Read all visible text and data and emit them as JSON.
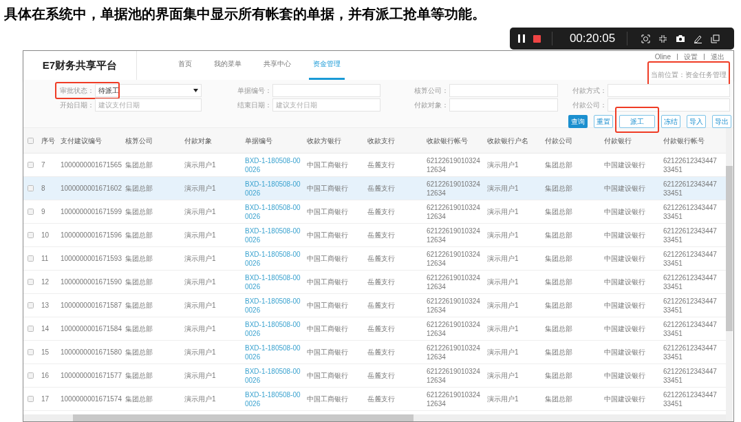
{
  "caption": "具体在系统中，单据池的界面集中显示所有帐套的单据，并有派工抢单等功能。",
  "recorder": {
    "time": "00:20:05"
  },
  "app": {
    "logo": "E7财务共享平台",
    "nav": [
      {
        "label": "首页",
        "selected": false
      },
      {
        "label": "我的菜单",
        "selected": false
      },
      {
        "label": "共享中心",
        "selected": false
      },
      {
        "label": "资金管理",
        "selected": true
      }
    ],
    "top_links": [
      "Oline",
      "设置",
      "退出"
    ],
    "location": {
      "text": "当前位置：资金任务管理",
      "highlighted": true
    }
  },
  "filters": [
    [
      {
        "label": "审批状态：",
        "kind": "select",
        "value": "待派工",
        "highlighted": true
      },
      {
        "label": "开始日期：",
        "kind": "text",
        "placeholder": "建议支付日期"
      }
    ],
    [
      {
        "label": "单据编号：",
        "kind": "text"
      },
      {
        "label": "结束日期：",
        "kind": "text",
        "placeholder": "建议支付日期"
      }
    ],
    [
      {
        "label": "核算公司：",
        "kind": "text"
      },
      {
        "label": "付款对象：",
        "kind": "text"
      }
    ],
    [
      {
        "label": "付款方式：",
        "kind": "text"
      },
      {
        "label": "付款公司：",
        "kind": "text"
      }
    ]
  ],
  "buttons": [
    {
      "label": "查询",
      "kind": "primary"
    },
    {
      "label": "重置",
      "kind": "outline"
    },
    {
      "label": "派工",
      "kind": "outline",
      "highlighted": true
    },
    {
      "label": "冻结",
      "kind": "outline"
    },
    {
      "label": "导入",
      "kind": "outline"
    },
    {
      "label": "导出",
      "kind": "outline"
    }
  ],
  "table": {
    "header_checked": false,
    "columns": [
      "序号",
      "支付建议编号",
      "核算公司",
      "付款对象",
      "单据编号",
      "收款方银行",
      "收款支行",
      "收款银行帐号",
      "收款银行户名",
      "付款公司",
      "付款银行",
      "付款银行帐号"
    ],
    "rows": [
      {
        "checked": false,
        "selected": false,
        "cells": [
          "7",
          "1000000001671565",
          "集团总部",
          "演示用户1",
          "BXD-1-180508-000026",
          "中国工商银行",
          "岳麓支行",
          "6212261901032412634",
          "演示用户1",
          "集团总部",
          "中国建设银行",
          "6212261234344733451"
        ]
      },
      {
        "checked": false,
        "selected": true,
        "cells": [
          "8",
          "1000000001671602",
          "集团总部",
          "演示用户1",
          "BXD-1-180508-000026",
          "中国工商银行",
          "岳麓支行",
          "6212261901032412634",
          "演示用户1",
          "集团总部",
          "中国建设银行",
          "6212261234344733451"
        ]
      },
      {
        "checked": false,
        "selected": false,
        "cells": [
          "9",
          "1000000001671599",
          "集团总部",
          "演示用户1",
          "BXD-1-180508-000026",
          "中国工商银行",
          "岳麓支行",
          "6212261901032412634",
          "演示用户1",
          "集团总部",
          "中国建设银行",
          "6212261234344733451"
        ]
      },
      {
        "checked": false,
        "selected": false,
        "cells": [
          "10",
          "1000000001671596",
          "集团总部",
          "演示用户1",
          "BXD-1-180508-000026",
          "中国工商银行",
          "岳麓支行",
          "6212261901032412634",
          "演示用户1",
          "集团总部",
          "中国建设银行",
          "6212261234344733451"
        ]
      },
      {
        "checked": false,
        "selected": false,
        "cells": [
          "11",
          "1000000001671593",
          "集团总部",
          "演示用户1",
          "BXD-1-180508-000026",
          "中国工商银行",
          "岳麓支行",
          "6212261901032412634",
          "演示用户1",
          "集团总部",
          "中国建设银行",
          "6212261234344733451"
        ]
      },
      {
        "checked": false,
        "selected": false,
        "cells": [
          "12",
          "1000000001671590",
          "集团总部",
          "演示用户1",
          "BXD-1-180508-000026",
          "中国工商银行",
          "岳麓支行",
          "6212261901032412634",
          "演示用户1",
          "集团总部",
          "中国建设银行",
          "6212261234344733451"
        ]
      },
      {
        "checked": false,
        "selected": false,
        "cells": [
          "13",
          "1000000001671587",
          "集团总部",
          "演示用户1",
          "BXD-1-180508-000026",
          "中国工商银行",
          "岳麓支行",
          "6212261901032412634",
          "演示用户1",
          "集团总部",
          "中国建设银行",
          "6212261234344733451"
        ]
      },
      {
        "checked": false,
        "selected": false,
        "cells": [
          "14",
          "1000000001671584",
          "集团总部",
          "演示用户1",
          "BXD-1-180508-000026",
          "中国工商银行",
          "岳麓支行",
          "6212261901032412634",
          "演示用户1",
          "集团总部",
          "中国建设银行",
          "6212261234344733451"
        ]
      },
      {
        "checked": false,
        "selected": false,
        "cells": [
          "15",
          "1000000001671580",
          "集团总部",
          "演示用户1",
          "BXD-1-180508-000026",
          "中国工商银行",
          "岳麓支行",
          "6212261901032412634",
          "演示用户1",
          "集团总部",
          "中国建设银行",
          "6212261234344733451"
        ]
      },
      {
        "checked": false,
        "selected": false,
        "cells": [
          "16",
          "1000000001671577",
          "集团总部",
          "演示用户1",
          "BXD-1-180508-000026",
          "中国工商银行",
          "岳麓支行",
          "6212261901032412634",
          "演示用户1",
          "集团总部",
          "中国建设银行",
          "6212261234344733451"
        ]
      },
      {
        "checked": false,
        "selected": false,
        "cells": [
          "17",
          "1000000001671574",
          "集团总部",
          "演示用户1",
          "BXD-1-180508-000026",
          "中国工商银行",
          "岳麓支行",
          "6212261901032412634",
          "演示用户1",
          "集团总部",
          "中国建设银行",
          "6212261234344733451"
        ]
      }
    ]
  }
}
